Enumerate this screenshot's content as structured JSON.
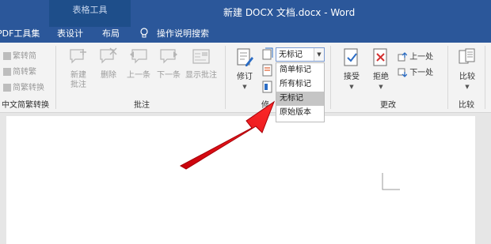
{
  "titlebar": {
    "context_tab": "表格工具",
    "doc_title": "新建 DOCX 文档.docx  -  Word"
  },
  "tabs": [
    "PDF工具集",
    "表设计",
    "布局",
    "操作说明搜索"
  ],
  "groups": {
    "chinese_conversion": {
      "items": [
        "繁转简",
        "简转繁",
        "简繁转换"
      ],
      "label": "中文简繁转换"
    },
    "comments": {
      "buttons": [
        "新建\n批注",
        "删除",
        "上一条",
        "下一条",
        "显示批注"
      ],
      "label": "批注"
    },
    "tracking": {
      "revision": "修订",
      "label": "修"
    },
    "changes": {
      "accept": "接受",
      "reject": "拒绝",
      "prev": "上一处",
      "next": "下一处",
      "label": "更改"
    },
    "compare": {
      "button": "比较",
      "label": "比较"
    }
  },
  "markup_dropdown": {
    "selected": "无标记",
    "options": [
      "简单标记",
      "所有标记",
      "无标记",
      "原始版本"
    ]
  },
  "colors": {
    "titlebar": "#2b579a",
    "arrow": "#e8141b"
  }
}
